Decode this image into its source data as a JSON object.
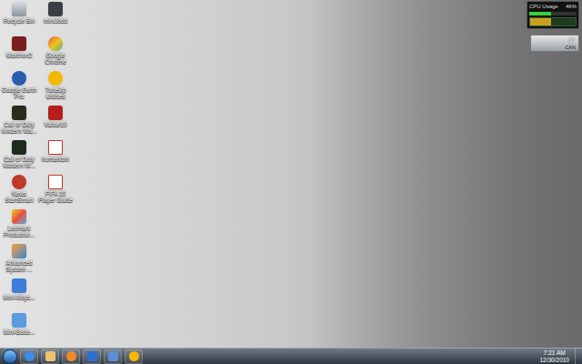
{
  "desktop": {
    "icons": [
      {
        "label": "Recycle Bin"
      },
      {
        "label": "Maxthon2"
      },
      {
        "label": "Google Earth Pro"
      },
      {
        "label": "Call of Duty Modern Wa..."
      },
      {
        "label": "Call of Duty Modern W..."
      },
      {
        "label": "News StartSmart"
      },
      {
        "label": "Lexmark Productivi..."
      },
      {
        "label": "Advanced System ..."
      },
      {
        "label": "Mini-Moys..."
      },
      {
        "label": "Mini-Butte..."
      },
      {
        "label": "miniJoob"
      },
      {
        "label": "Google Chrome"
      },
      {
        "label": "TuneUp Utilities"
      },
      {
        "label": "Vallue10"
      },
      {
        "label": "humanism"
      },
      {
        "label": "FIFA 10 Player Guide"
      }
    ]
  },
  "gadgets": {
    "cpu": {
      "label": "CPU Usage",
      "value": "46%",
      "level": 0.46
    },
    "weather": {
      "temperature": "3°",
      "location": "CAN"
    }
  },
  "taskbar": {
    "clock": {
      "time": "7:21 AM",
      "date": "12/30/2010"
    }
  }
}
